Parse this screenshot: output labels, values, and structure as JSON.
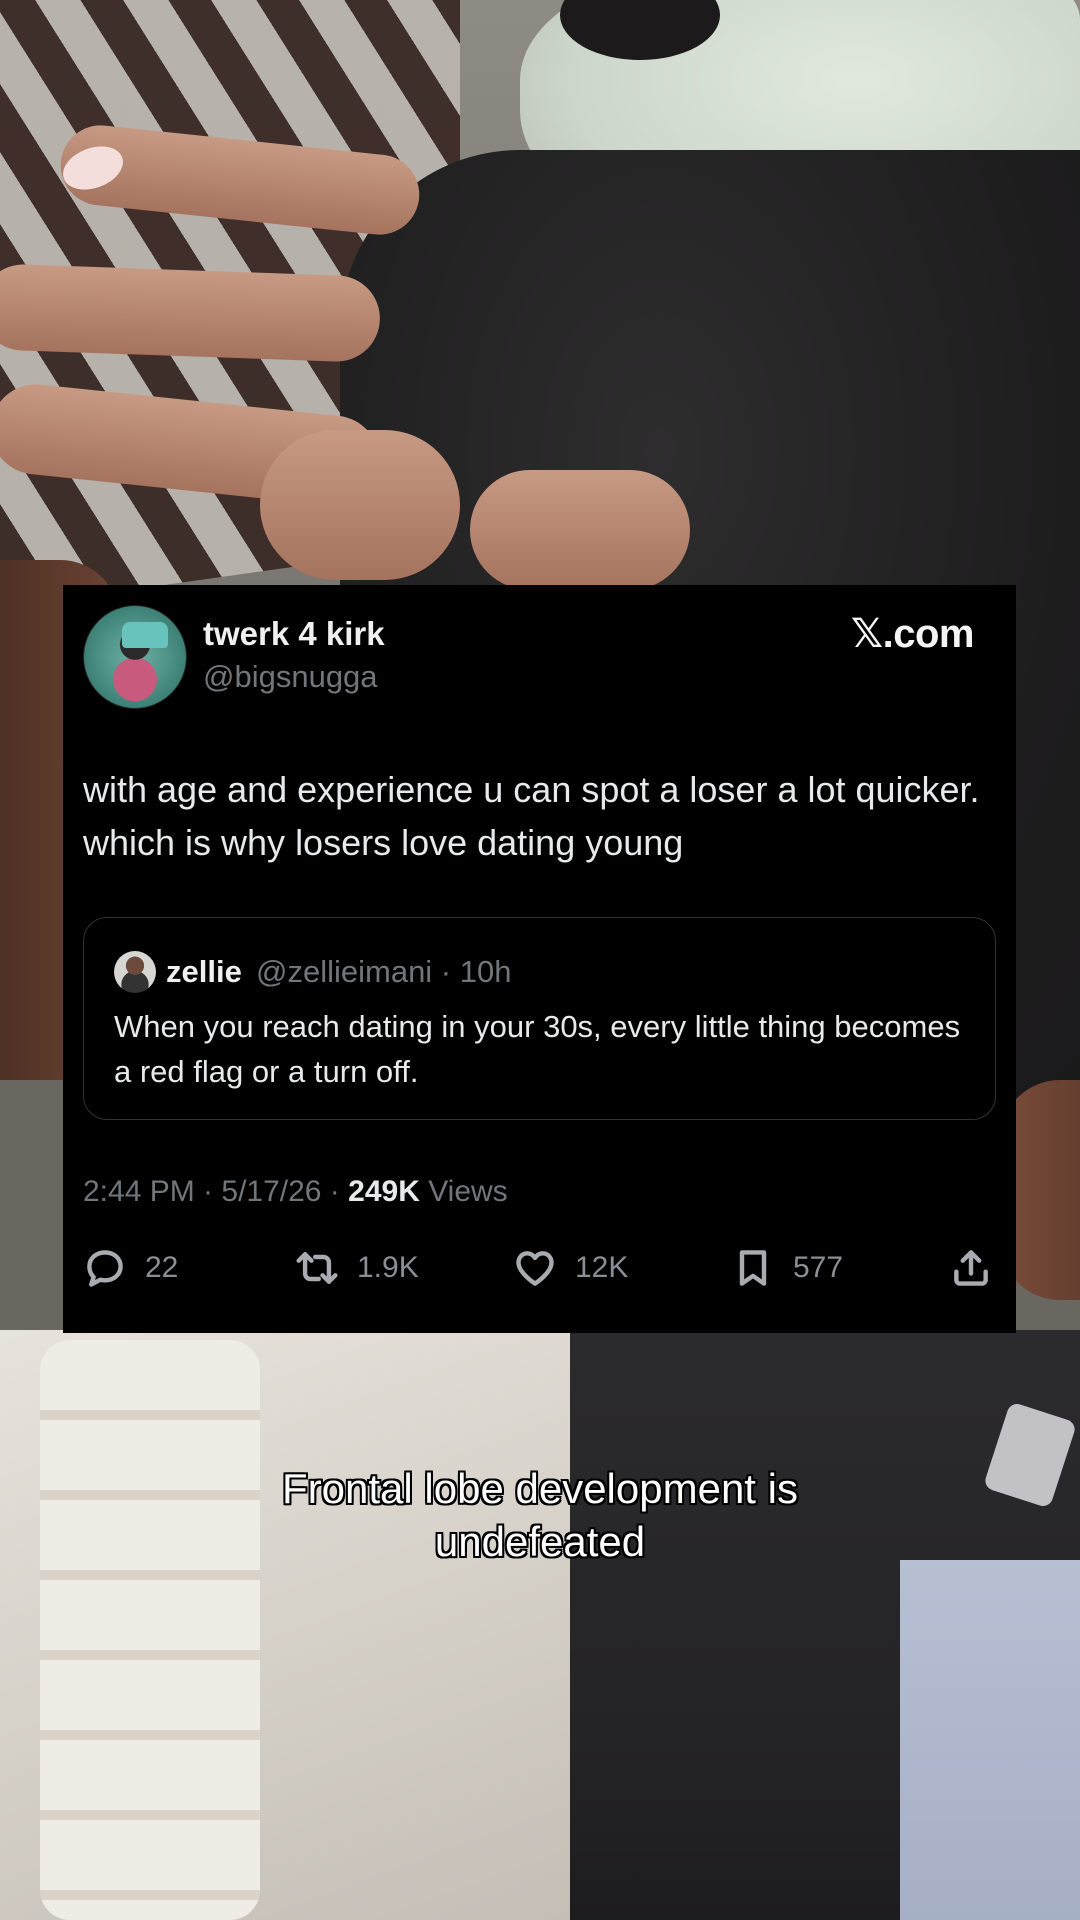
{
  "tweet": {
    "author_name": "twerk 4 kirk",
    "author_handle": "@bigsnugga",
    "brand": "𝕏.com",
    "text": "with age and experience u can spot a loser a lot quicker. which is why losers love dating young",
    "quoted": {
      "name": "zellie",
      "handle_time": "@zellieimani · 10h",
      "text": "When you reach dating in your 30s, every little thing becomes a red flag or a turn off."
    },
    "timestamp": "2:44 PM · 5/17/26 · ",
    "views_count": "249K",
    "views_label": " Views",
    "actions": {
      "replies": "22",
      "reposts": "1.9K",
      "likes": "12K",
      "bookmarks": "577"
    }
  },
  "caption": {
    "line1": "Frontal lobe development is",
    "line2": "undefeated"
  },
  "icons": [
    "reply-icon",
    "repost-icon",
    "like-icon",
    "bookmark-icon",
    "share-icon"
  ],
  "colors": {
    "card_bg": "#000000",
    "primary_text": "#e7e9ea",
    "secondary_text": "#71767b",
    "quote_border": "#2f3336"
  }
}
